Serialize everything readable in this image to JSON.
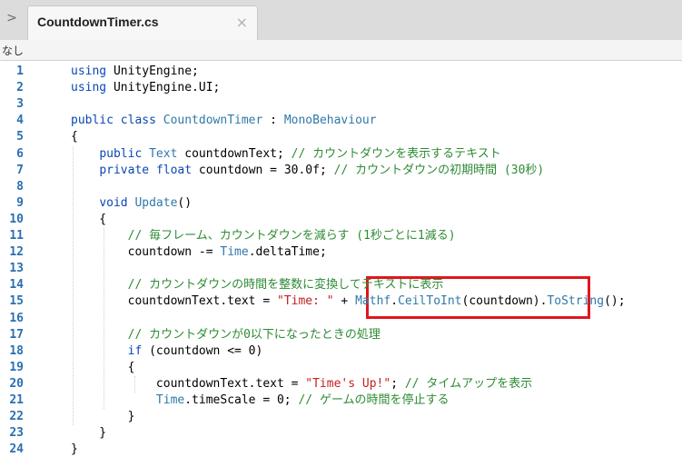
{
  "tab": {
    "arrow": ">",
    "title": "CountdownTimer.cs",
    "close": "×"
  },
  "breadcrumb": "なし",
  "colors": {
    "keyword": "#0b47b5",
    "type": "#2e79a9",
    "string": "#c2221f",
    "comment": "#2e8b34",
    "line_number": "#2a6fb3",
    "highlight": "#e0161e"
  },
  "lines": [
    {
      "n": "1",
      "tokens": [
        {
          "t": "using",
          "c": "kw"
        },
        {
          "t": " UnityEngine;",
          "c": ""
        }
      ]
    },
    {
      "n": "2",
      "tokens": [
        {
          "t": "using",
          "c": "kw"
        },
        {
          "t": " UnityEngine.UI;",
          "c": ""
        }
      ]
    },
    {
      "n": "3",
      "tokens": []
    },
    {
      "n": "4",
      "tokens": [
        {
          "t": "public class",
          "c": "kw"
        },
        {
          "t": " ",
          "c": ""
        },
        {
          "t": "CountdownTimer",
          "c": "ty"
        },
        {
          "t": " : ",
          "c": ""
        },
        {
          "t": "MonoBehaviour",
          "c": "ty"
        }
      ]
    },
    {
      "n": "5",
      "tokens": [
        {
          "t": "{",
          "c": ""
        }
      ]
    },
    {
      "n": "6",
      "tokens": [
        {
          "t": "    ",
          "c": ""
        },
        {
          "t": "public",
          "c": "kw"
        },
        {
          "t": " ",
          "c": ""
        },
        {
          "t": "Text",
          "c": "ty"
        },
        {
          "t": " countdownText; ",
          "c": ""
        },
        {
          "t": "// カウントダウンを表示するテキスト",
          "c": "cm"
        }
      ]
    },
    {
      "n": "7",
      "tokens": [
        {
          "t": "    ",
          "c": ""
        },
        {
          "t": "private",
          "c": "kw"
        },
        {
          "t": " ",
          "c": ""
        },
        {
          "t": "float",
          "c": "kw"
        },
        {
          "t": " countdown = 30.0f; ",
          "c": ""
        },
        {
          "t": "// カウントダウンの初期時間 (30秒)",
          "c": "cm"
        }
      ]
    },
    {
      "n": "8",
      "tokens": []
    },
    {
      "n": "9",
      "tokens": [
        {
          "t": "    ",
          "c": ""
        },
        {
          "t": "void",
          "c": "kw"
        },
        {
          "t": " ",
          "c": ""
        },
        {
          "t": "Update",
          "c": "ty"
        },
        {
          "t": "()",
          "c": ""
        }
      ]
    },
    {
      "n": "10",
      "tokens": [
        {
          "t": "    {",
          "c": ""
        }
      ]
    },
    {
      "n": "11",
      "tokens": [
        {
          "t": "        ",
          "c": ""
        },
        {
          "t": "// 毎フレーム、カウントダウンを減らす (1秒ごとに1減る)",
          "c": "cm"
        }
      ]
    },
    {
      "n": "12",
      "tokens": [
        {
          "t": "        countdown -= ",
          "c": ""
        },
        {
          "t": "Time",
          "c": "ty"
        },
        {
          "t": ".deltaTime;",
          "c": ""
        }
      ]
    },
    {
      "n": "13",
      "tokens": []
    },
    {
      "n": "14",
      "tokens": [
        {
          "t": "        ",
          "c": ""
        },
        {
          "t": "// カウントダウンの時間を整数に変換してテキストに表示",
          "c": "cm"
        }
      ]
    },
    {
      "n": "15",
      "tokens": [
        {
          "t": "        countdownText.text = ",
          "c": ""
        },
        {
          "t": "\"Time: \"",
          "c": "str"
        },
        {
          "t": " + ",
          "c": ""
        },
        {
          "t": "Mathf",
          "c": "ty"
        },
        {
          "t": ".",
          "c": ""
        },
        {
          "t": "CeilToInt",
          "c": "ty"
        },
        {
          "t": "(countdown).",
          "c": ""
        },
        {
          "t": "ToString",
          "c": "ty"
        },
        {
          "t": "();",
          "c": ""
        }
      ]
    },
    {
      "n": "16",
      "tokens": []
    },
    {
      "n": "17",
      "tokens": [
        {
          "t": "        ",
          "c": ""
        },
        {
          "t": "// カウントダウンが0以下になったときの処理",
          "c": "cm"
        }
      ]
    },
    {
      "n": "18",
      "tokens": [
        {
          "t": "        ",
          "c": ""
        },
        {
          "t": "if",
          "c": "kw"
        },
        {
          "t": " (countdown <= 0)",
          "c": ""
        }
      ]
    },
    {
      "n": "19",
      "tokens": [
        {
          "t": "        {",
          "c": ""
        }
      ]
    },
    {
      "n": "20",
      "tokens": [
        {
          "t": "            countdownText.text = ",
          "c": ""
        },
        {
          "t": "\"Time's Up!\"",
          "c": "str"
        },
        {
          "t": "; ",
          "c": ""
        },
        {
          "t": "// タイムアップを表示",
          "c": "cm"
        }
      ]
    },
    {
      "n": "21",
      "tokens": [
        {
          "t": "            ",
          "c": ""
        },
        {
          "t": "Time",
          "c": "ty"
        },
        {
          "t": ".timeScale = 0; ",
          "c": ""
        },
        {
          "t": "// ゲームの時間を停止する",
          "c": "cm"
        }
      ]
    },
    {
      "n": "22",
      "tokens": [
        {
          "t": "        }",
          "c": ""
        }
      ]
    },
    {
      "n": "23",
      "tokens": [
        {
          "t": "    }",
          "c": ""
        }
      ]
    },
    {
      "n": "24",
      "tokens": [
        {
          "t": "}",
          "c": ""
        }
      ]
    }
  ]
}
